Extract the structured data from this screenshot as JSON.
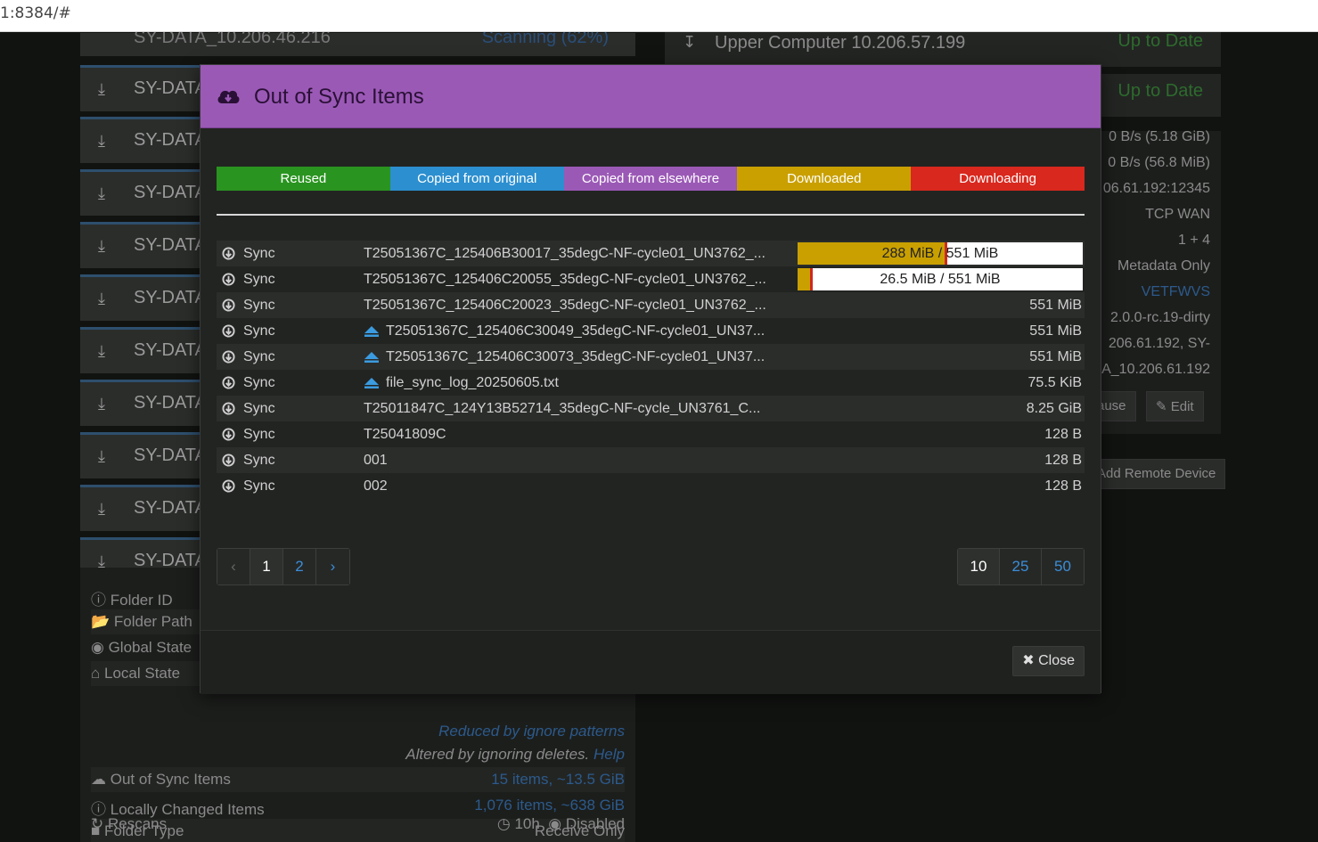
{
  "address": {
    "url": "1:8384/#"
  },
  "background": {
    "top_folder": {
      "name": "SY-DATA_10.206.46.216",
      "status": "Scanning (62%)"
    },
    "folders": [
      {
        "name": "SY-DATA"
      },
      {
        "name": "SY-DATA"
      },
      {
        "name": "SY-DATA"
      },
      {
        "name": "SY-DATA"
      },
      {
        "name": "SY-DATA"
      },
      {
        "name": "SY-DATA"
      },
      {
        "name": "SY-DATA"
      },
      {
        "name": "SY-DATA"
      },
      {
        "name": "SY-DATA"
      },
      {
        "name": "SY-DATA"
      }
    ],
    "details": {
      "folder_id": "Folder ID",
      "folder_path": "Folder Path",
      "global_state": "Global State",
      "local_state": "Local State",
      "reduced_note": "Reduced by ignore patterns",
      "altered_note": "Altered by ignoring deletes.",
      "help": "Help",
      "out_of_sync_label": "Out of Sync Items",
      "out_of_sync_value": "15 items, ~13.5 GiB",
      "locally_changed_label": "Locally Changed Items",
      "locally_changed_value": "1,076 items, ~638 GiB",
      "folder_type_label": "Folder Type",
      "folder_type_value": "Receive Only",
      "rescans_label": "Rescans",
      "rescans_interval": "10h",
      "rescans_watch": "Disabled"
    },
    "devices": {
      "upper": {
        "name": "Upper Computer 10.206.57.199",
        "status": "Up to Date"
      },
      "second_status": "Up to Date",
      "rows": [
        "0 B/s (5.18 GiB)",
        "0 B/s (56.8 MiB)",
        "06.61.192:12345",
        "TCP WAN",
        "1 + 4",
        "Metadata Only",
        "VETFWVS",
        "2.0.0-rc.19-dirty",
        "206.61.192, SY-",
        "A_10.206.61.192"
      ],
      "pause": "ause",
      "edit": "Edit",
      "add_remote": "Add Remote Device"
    }
  },
  "modal": {
    "title": "Out of Sync Items",
    "legend": [
      {
        "label": "Reused",
        "color": "#2a9420"
      },
      {
        "label": "Copied from original",
        "color": "#2c8fd0"
      },
      {
        "label": "Copied from elsewhere",
        "color": "#9b59b6"
      },
      {
        "label": "Downloaded",
        "color": "#c9a000"
      },
      {
        "label": "Downloading",
        "color": "#d9281e"
      }
    ],
    "rows": [
      {
        "action": "Sync",
        "name": "T25051367C_125406B30017_35degC-NF-cycle01_UN3762_...",
        "progress": "288 MiB / 551 MiB",
        "progress_fraction": 0.52,
        "upload": false
      },
      {
        "action": "Sync",
        "name": "T25051367C_125406C20055_35degC-NF-cycle01_UN3762_...",
        "progress": "26.5 MiB / 551 MiB",
        "progress_fraction": 0.048,
        "upload": false
      },
      {
        "action": "Sync",
        "name": "T25051367C_125406C20023_35degC-NF-cycle01_UN3762_...",
        "size": "551 MiB",
        "upload": false
      },
      {
        "action": "Sync",
        "name": "T25051367C_125406C30049_35degC-NF-cycle01_UN37...",
        "size": "551 MiB",
        "upload": true
      },
      {
        "action": "Sync",
        "name": "T25051367C_125406C30073_35degC-NF-cycle01_UN37...",
        "size": "551 MiB",
        "upload": true
      },
      {
        "action": "Sync",
        "name": "file_sync_log_20250605.txt",
        "size": "75.5 KiB",
        "upload": true
      },
      {
        "action": "Sync",
        "name": "T25011847C_124Y13B52714_35degC-NF-cycle_UN3761_C...",
        "size": "8.25 GiB",
        "upload": false
      },
      {
        "action": "Sync",
        "name": "T25041809C",
        "size": "128 B",
        "upload": false
      },
      {
        "action": "Sync",
        "name": "001",
        "size": "128 B",
        "upload": false
      },
      {
        "action": "Sync",
        "name": "002",
        "size": "128 B",
        "upload": false
      }
    ],
    "pagination": {
      "prev": "‹",
      "pages": [
        "1",
        "2"
      ],
      "current": "1",
      "next": "›"
    },
    "page_sizes": [
      "10",
      "25",
      "50"
    ],
    "page_size_current": "10",
    "close_label": "Close"
  }
}
